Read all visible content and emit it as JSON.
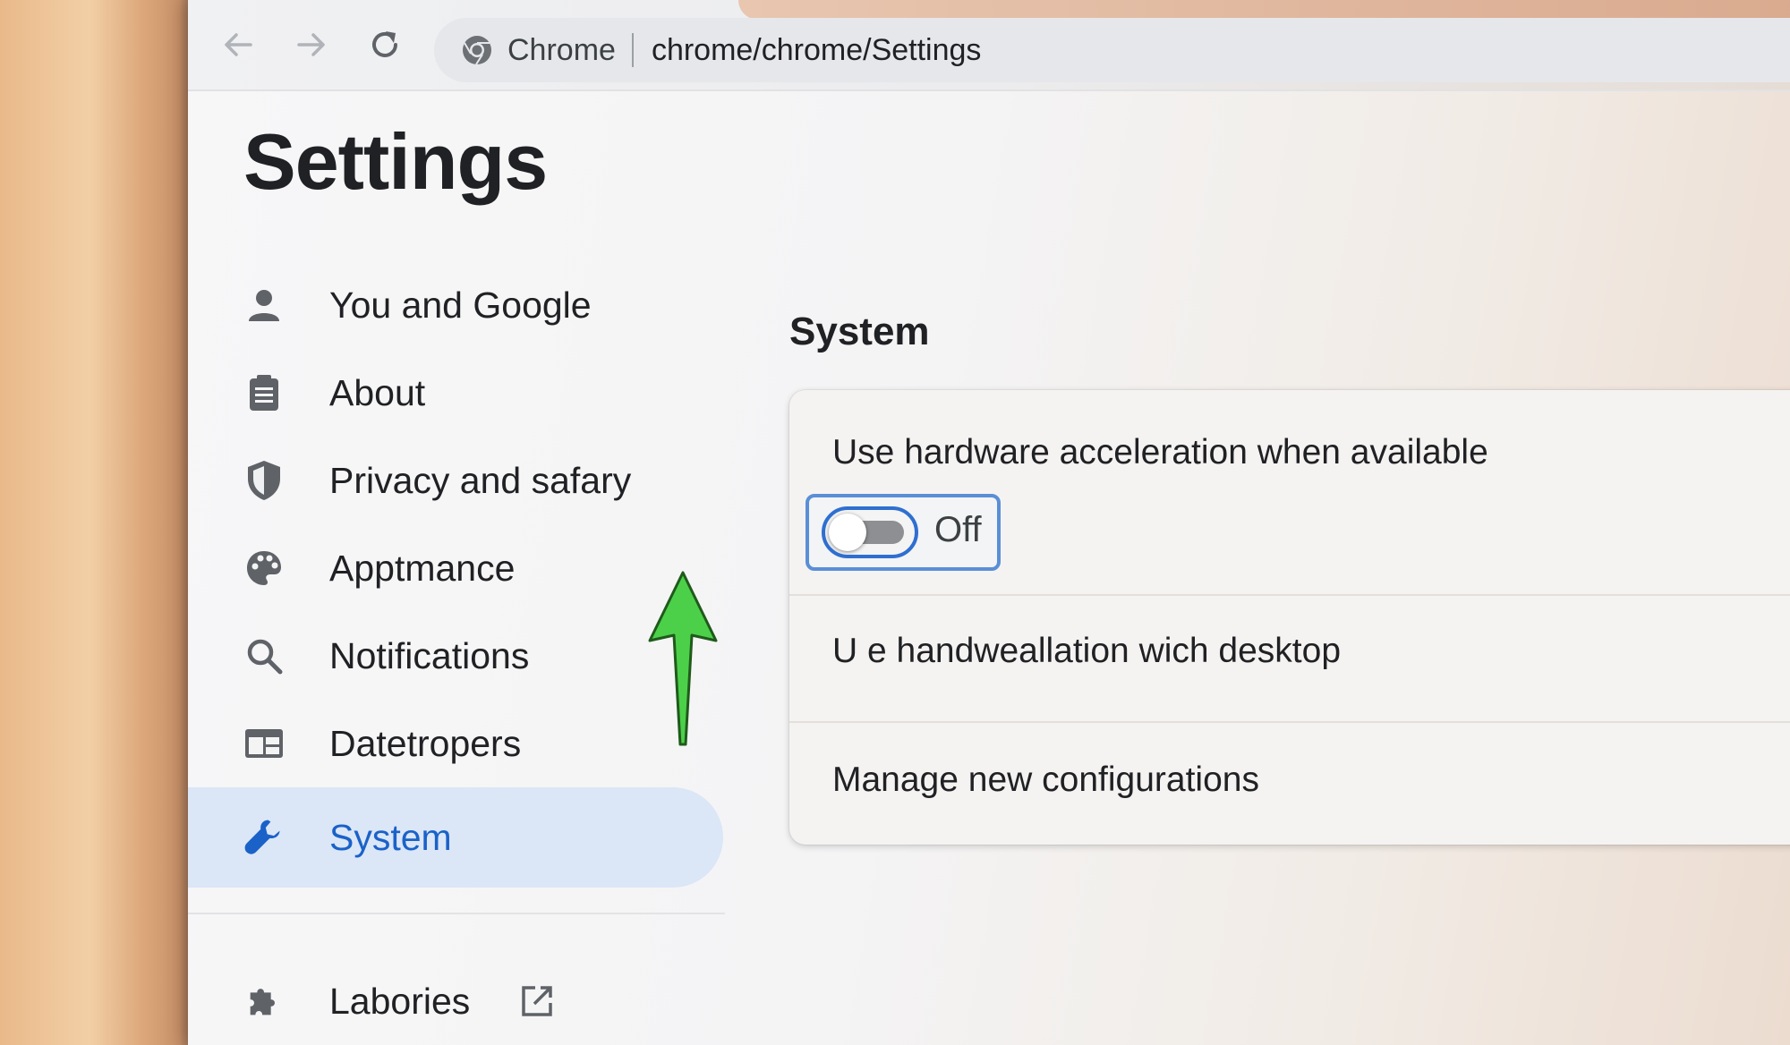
{
  "browser": {
    "omnibox_label": "Chrome",
    "url": "chrome/chrome/Settings"
  },
  "page": {
    "title": "Settings"
  },
  "sidebar": {
    "items": [
      {
        "label": "You and Google",
        "icon": "person-icon"
      },
      {
        "label": "About",
        "icon": "clipboard-icon"
      },
      {
        "label": "Privacy and safary",
        "icon": "shield-icon"
      },
      {
        "label": "Apptmance",
        "icon": "palette-icon"
      },
      {
        "label": "Notifications",
        "icon": "search-icon"
      },
      {
        "label": "Datetropers",
        "icon": "browser-window-icon"
      },
      {
        "label": "System",
        "icon": "wrench-icon",
        "active": true
      },
      {
        "label": "Labories",
        "icon": "puzzle-icon",
        "external": true
      }
    ]
  },
  "main": {
    "section_title": "System",
    "rows": [
      {
        "label": "Use hardware acceleration when available"
      },
      {
        "label": "U e handweallation wich desktop"
      },
      {
        "label": "Manage new configurations"
      }
    ],
    "toggle": {
      "state_label": "Off",
      "on": false
    }
  },
  "colors": {
    "accent": "#1a62c8",
    "active_nav_bg": "#dbe6f7",
    "annotation_arrow": "#4cd04a"
  }
}
